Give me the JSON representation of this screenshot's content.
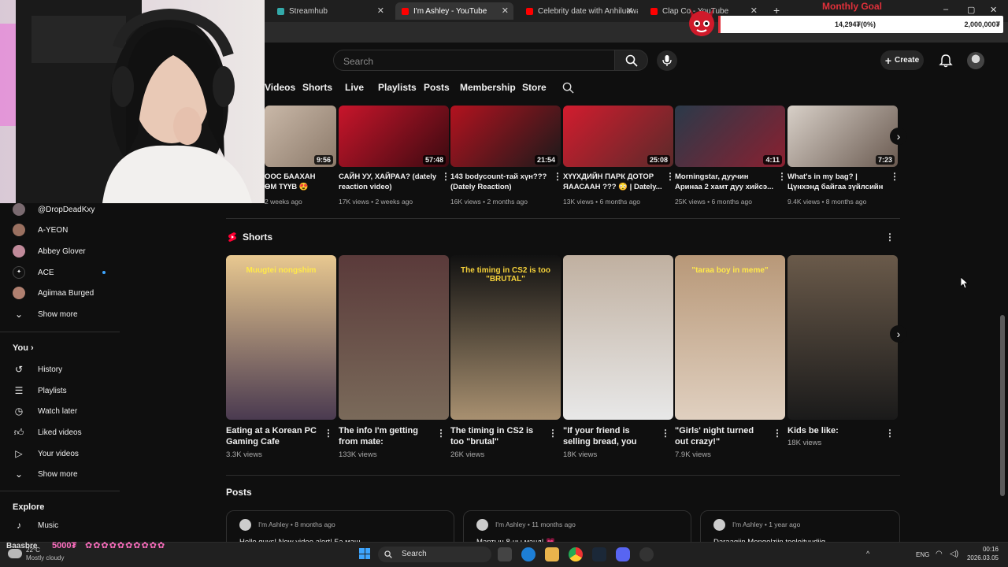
{
  "browser": {
    "tabs": [
      {
        "label": "Streamhub",
        "active": false
      },
      {
        "label": "I'm Ashley - YouTube",
        "active": true
      },
      {
        "label": "Celebrity date with Anhiluuwan",
        "active": false
      },
      {
        "label": "Clap Co - YouTube",
        "active": false
      }
    ],
    "new_tab": "+",
    "window_controls": [
      "–",
      "▢",
      "✕"
    ]
  },
  "overlay": {
    "goal_title": "Monthly Goal",
    "goal_progress_text": "14,294₮(0%)",
    "goal_target": "2,000,000₮",
    "goal_fraction": 0.007,
    "donation_text": "5000₮",
    "donor": "Baasbre"
  },
  "header": {
    "search_placeholder": "Search",
    "create_label": "Create"
  },
  "channel_tabs": [
    "Videos",
    "Shorts",
    "Live",
    "Playlists",
    "Posts",
    "Membership",
    "Store"
  ],
  "videos": [
    {
      "title": "ООС БААХАН ӨМ ТҮҮВ 😍",
      "meta": "2 weeks ago",
      "duration": "9:56",
      "colors": [
        "#c9b8a8",
        "#8c7a6a"
      ]
    },
    {
      "title": "САЙН УУ, ХАЙРАА? (dately reaction video)",
      "meta": "17K views • 2 weeks ago",
      "duration": "57:48",
      "colors": [
        "#c8152b",
        "#3a0a10"
      ]
    },
    {
      "title": "143 bodycount-тай хүн??? (Dately Reaction)",
      "meta": "16K views • 2 months ago",
      "duration": "21:54",
      "colors": [
        "#b3121f",
        "#1a1a1a"
      ]
    },
    {
      "title": "ХҮҮХДИЙН ПАРК ДОТОР ЯААСААН ??? 😳 | Dately...",
      "meta": "13K views • 6 months ago",
      "duration": "25:08",
      "colors": [
        "#d21c2e",
        "#5a2a2a"
      ]
    },
    {
      "title": "Morningstar, дуучин Аринаа 2 хамт дуу хийсэ...",
      "meta": "25K views • 6 months ago",
      "duration": "4:11",
      "colors": [
        "#2a3a4a",
        "#8a2030"
      ]
    },
    {
      "title": "What's in my bag? | Цүнхэнд байгаа зүйлсийн үнэ ₮ |...",
      "meta": "9.4K views • 8 months ago",
      "duration": "7:23",
      "colors": [
        "#d8d0c8",
        "#6a5a50"
      ]
    }
  ],
  "shorts_section": {
    "title": "Shorts"
  },
  "shorts": [
    {
      "title": "Eating at a Korean PC Gaming Cafe",
      "views": "3.3K views",
      "caption": "Muugtei nongshim",
      "colors": [
        "#e8c890",
        "#4a3a50"
      ]
    },
    {
      "title": "The info I'm getting from mate:",
      "views": "133K views",
      "caption": "",
      "colors": [
        "#5a3a3a",
        "#7a6a5a"
      ]
    },
    {
      "title": "The timing in CS2 is too \"brutal\"",
      "views": "26K views",
      "caption": "The timing in CS2 is too \"BRUTAL\"",
      "colors": [
        "#111111",
        "#a89070"
      ]
    },
    {
      "title": "\"If your friend is selling bread, you should pay ...",
      "views": "18K views",
      "caption": "",
      "colors": [
        "#c0b0a0",
        "#e8e8e8"
      ]
    },
    {
      "title": "\"Girls' night turned out crazy!\"",
      "views": "7.9K views",
      "caption": "\"taraa boy in meme\"",
      "colors": [
        "#b89878",
        "#e0d0c0"
      ]
    },
    {
      "title": "Kids be like:",
      "views": "18K views",
      "caption": "",
      "colors": [
        "#6a5a4a",
        "#1a1a1a"
      ]
    }
  ],
  "posts_section": {
    "title": "Posts"
  },
  "posts": [
    {
      "author": "I'm Ashley",
      "time": "8 months ago",
      "text": "Hello guys! New video alert! Бэ маш..."
    },
    {
      "author": "I'm Ashley",
      "time": "11 months ago",
      "text": "Мартын 8-ны мэнд! 💗"
    },
    {
      "author": "I'm Ashley",
      "time": "1 year ago",
      "text": "Daraagiin Mongolziin tooloituudiig..."
    }
  ],
  "sidebar": {
    "subscriptions": [
      {
        "label": "@DropDeadKxy",
        "color": "#7a6a70"
      },
      {
        "label": "A-YEON",
        "color": "#9a7060"
      },
      {
        "label": "Abbey Glover",
        "color": "#c08a9a"
      },
      {
        "label": "ACE",
        "color": "#1a1a1a",
        "live_dot": true
      },
      {
        "label": "Agiimaa Burged",
        "color": "#b08070"
      }
    ],
    "show_more_1": "Show more",
    "you_title": "You",
    "you_items": [
      {
        "label": "History",
        "icon": "history-icon"
      },
      {
        "label": "Playlists",
        "icon": "playlists-icon"
      },
      {
        "label": "Watch later",
        "icon": "watch-later-icon"
      },
      {
        "label": "Liked videos",
        "icon": "like-icon"
      },
      {
        "label": "Your videos",
        "icon": "your-videos-icon"
      }
    ],
    "show_more_2": "Show more",
    "explore_title": "Explore",
    "explore_items": [
      {
        "label": "Music",
        "icon": "music-icon"
      }
    ]
  },
  "taskbar": {
    "weather_temp": "22°C",
    "weather_text": "Mostly cloudy",
    "search_label": "Search",
    "language": "ENG",
    "time": "00:16",
    "date": "2026.03.05"
  }
}
